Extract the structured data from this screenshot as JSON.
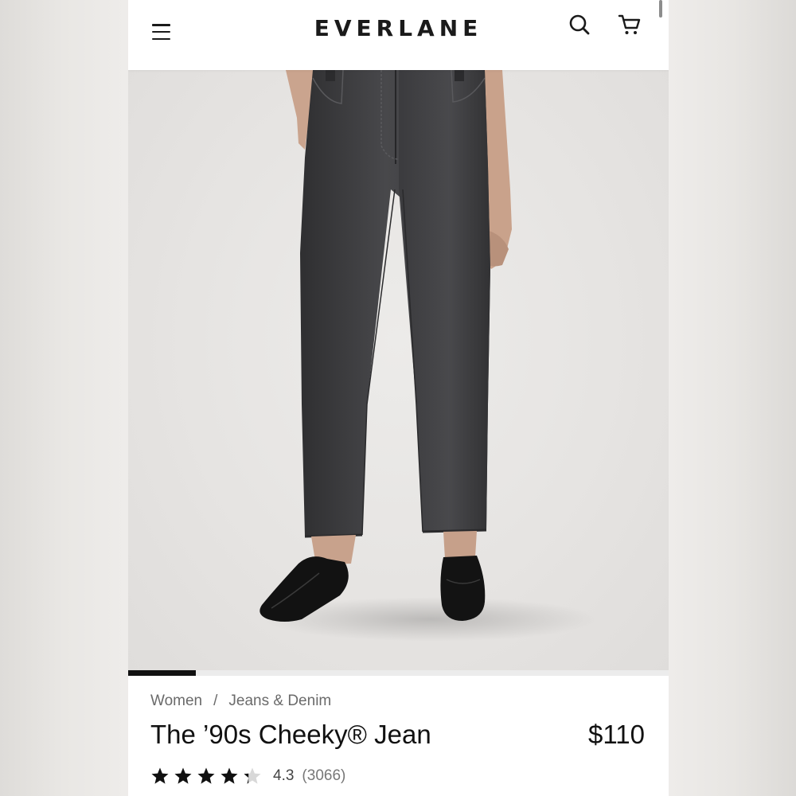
{
  "header": {
    "brand": "EVERLANE",
    "icons": [
      "menu-icon",
      "search-icon",
      "cart-icon"
    ]
  },
  "gallery": {
    "image_alt": "Model wearing washed black straight-leg jeans with black loafers",
    "progress_fraction": 0.125
  },
  "breadcrumb": {
    "items": [
      "Women",
      "Jeans & Denim"
    ],
    "separator": "/"
  },
  "product": {
    "title": "The ’90s Cheeky® Jean",
    "price": "$110",
    "rating": "4.3",
    "rating_value": 4.3,
    "review_count": "(3066)"
  },
  "colors": {
    "text": "#1a1a1a",
    "muted": "#6a6a6a",
    "denim": "#3e3e40",
    "background": "#ffffff"
  }
}
